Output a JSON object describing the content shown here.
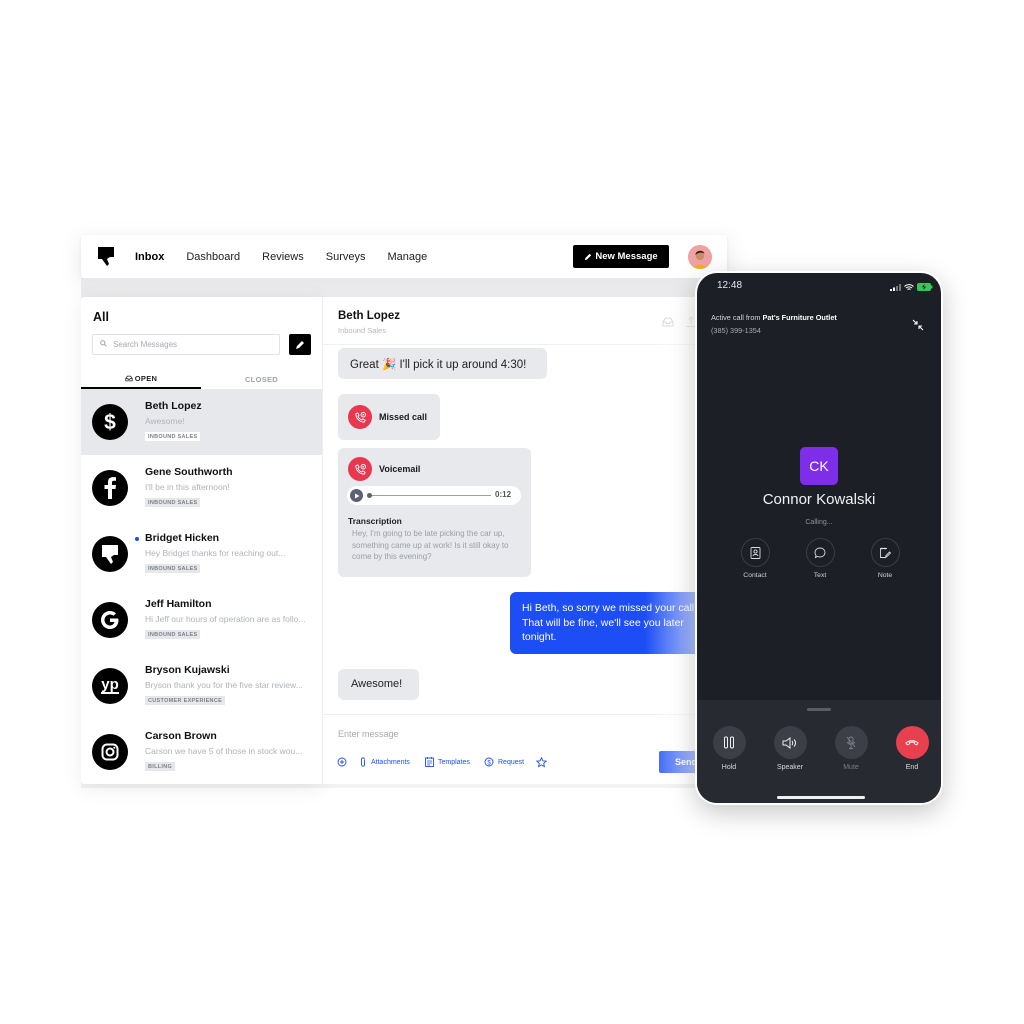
{
  "topbar": {
    "nav": [
      "Inbox",
      "Dashboard",
      "Reviews",
      "Surveys",
      "Manage"
    ],
    "active_nav": "Inbox",
    "new_message_label": "New Message"
  },
  "inbox": {
    "title": "All",
    "search_placeholder": "Search Messages",
    "tabs": [
      "OPEN",
      "CLOSED"
    ],
    "conversations": [
      {
        "name": "Beth Lopez",
        "preview": "Awesome!",
        "tag": "INBOUND SALES",
        "source": "payment-icon",
        "selected": true,
        "unread": false
      },
      {
        "name": "Gene Southworth",
        "preview": "I'll be in this afternoon!",
        "tag": "INBOUND SALES",
        "source": "facebook-icon",
        "selected": false,
        "unread": false
      },
      {
        "name": "Bridget Hicken",
        "preview": "Hey Bridget thanks for reaching out...",
        "tag": "INBOUND SALES",
        "source": "podium-icon",
        "selected": false,
        "unread": true
      },
      {
        "name": "Jeff Hamilton",
        "preview": "Hi Jeff our hours of operation are as follo...",
        "tag": "INBOUND SALES",
        "source": "google-icon",
        "selected": false,
        "unread": false
      },
      {
        "name": "Bryson Kujawski",
        "preview": "Bryson thank you for the five star review...",
        "tag": "CUSTOMER EXPERIENCE",
        "source": "yelp-icon",
        "selected": false,
        "unread": false
      },
      {
        "name": "Carson Brown",
        "preview": "Carson we have 5 of those in stock wou...",
        "tag": "BILLING",
        "source": "instagram-icon",
        "selected": false,
        "unread": false
      }
    ]
  },
  "chat": {
    "contact_name": "Beth Lopez",
    "contact_team": "Inbound Sales",
    "messages": {
      "great": "Great 🎉 I'll pick it up around 4:30!",
      "missed_call": "Missed call",
      "voicemail": "Voicemail",
      "voicemail_duration": "0:12",
      "transcription_label": "Transcription",
      "transcription": "Hey, I'm going to be late picking the car up, something came up at work! Is it still okay to come by this evening?",
      "outgoing": "Hi Beth, so sorry we missed your call. That will be fine, we'll see you later tonight.",
      "awesome": "Awesome!"
    },
    "composer": {
      "placeholder": "Enter message",
      "tools": [
        "Attachments",
        "Templates",
        "Request"
      ],
      "send_label": "Send"
    }
  },
  "phone": {
    "time": "12:48",
    "active_call_prefix": "Active call from",
    "business": "Pat's Furniture Outlet",
    "number": "(385) 399-1354",
    "initials": "CK",
    "caller_name": "Connor Kowalski",
    "status": "Calling...",
    "actions": [
      "Contact",
      "Text",
      "Note"
    ],
    "controls": [
      "Hold",
      "Speaker",
      "Mute",
      "End"
    ]
  },
  "colors": {
    "accent_blue": "#1d4ef5",
    "missed_red": "#e8374f",
    "avatar_purple": "#7e2ee8",
    "phone_bg": "#1d1f26"
  }
}
